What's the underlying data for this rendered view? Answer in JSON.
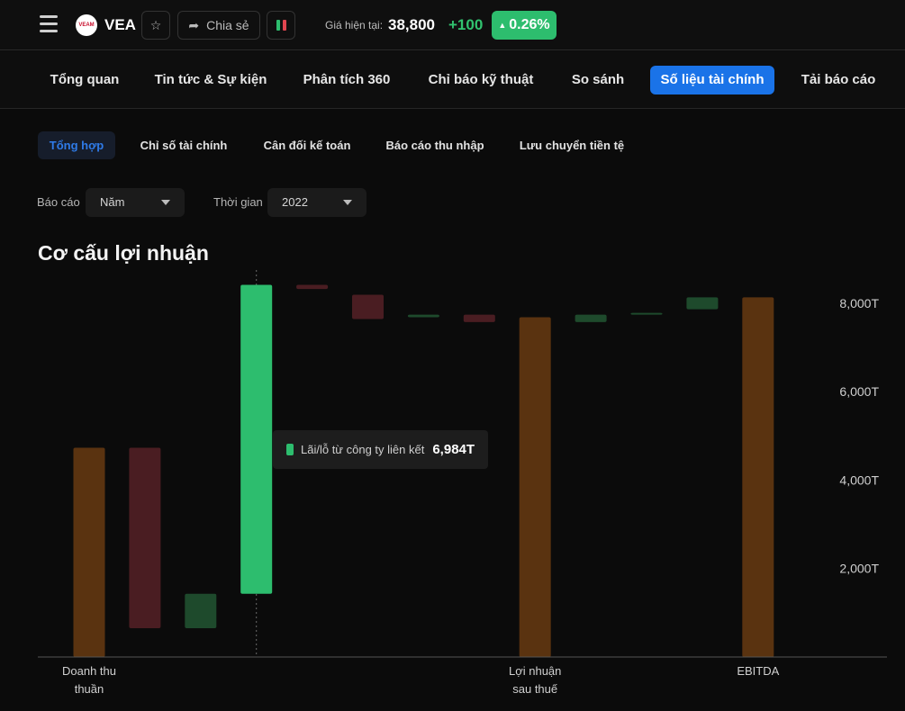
{
  "header": {
    "ticker": "VEA",
    "share_label": "Chia sẻ",
    "price_label": "Giá hiện tại:",
    "price_value": "38,800",
    "price_change": "+100",
    "price_change_pct": "0.26%",
    "icons": {
      "menu": "menu-icon",
      "star": "star-icon",
      "share": "share-icon",
      "candles": "candlestick-icon"
    }
  },
  "main_tabs": [
    "Tổng quan",
    "Tin tức & Sự kiện",
    "Phân tích 360",
    "Chỉ báo kỹ thuật",
    "So sánh",
    "Số liệu tài chính",
    "Tải báo cáo"
  ],
  "active_main_tab": "Số liệu tài chính",
  "sub_tabs": [
    "Tổng hợp",
    "Chỉ số tài chính",
    "Cân đối kế toán",
    "Báo cáo thu nhập",
    "Lưu chuyển tiền tệ"
  ],
  "active_sub_tab": "Tổng hợp",
  "filters": {
    "report_label": "Báo cáo",
    "report_value": "Năm",
    "time_label": "Thời gian",
    "time_value": "2022"
  },
  "chart_title": "Cơ cấu lợi nhuận",
  "tooltip": {
    "label": "Lãi/lỗ từ công ty liên kết",
    "value": "6,984T"
  },
  "colors": {
    "total": "#5a3310",
    "negative": "#4a1d22",
    "positive": "#1e4a2c",
    "highlight": "#2dbd6e",
    "accent": "#1a73e8"
  },
  "chart_data": {
    "type": "bar",
    "subtype": "waterfall",
    "unit": "T",
    "ylim": [
      0,
      8400
    ],
    "yticks": [
      2000,
      4000,
      6000,
      8000
    ],
    "ytick_labels": [
      "2,000T",
      "4,000T",
      "6,000T",
      "8,000T"
    ],
    "category_labels": [
      {
        "index": 0,
        "lines": [
          "Doanh thu",
          "thuần"
        ]
      },
      {
        "index": 8,
        "lines": [
          "Lợi nhuận",
          "sau thuế"
        ]
      },
      {
        "index": 12,
        "lines": [
          "EBITDA"
        ]
      }
    ],
    "bars": [
      {
        "kind": "total",
        "start": 0,
        "end": 4730
      },
      {
        "kind": "negative",
        "start": 4730,
        "end": 650
      },
      {
        "kind": "positive",
        "start": 650,
        "end": 1430
      },
      {
        "kind": "highlight",
        "start": 1430,
        "end": 8414
      },
      {
        "kind": "negative",
        "start": 8414,
        "end": 8320
      },
      {
        "kind": "negative",
        "start": 8190,
        "end": 7640
      },
      {
        "kind": "positive",
        "start": 7680,
        "end": 7740
      },
      {
        "kind": "negative",
        "start": 7740,
        "end": 7570
      },
      {
        "kind": "total",
        "start": 0,
        "end": 7680
      },
      {
        "kind": "positive",
        "start": 7570,
        "end": 7740
      },
      {
        "kind": "positive",
        "start": 7740,
        "end": 7780
      },
      {
        "kind": "positive",
        "start": 7860,
        "end": 8130
      },
      {
        "kind": "total",
        "start": 0,
        "end": 8130
      }
    ],
    "hover_index": 3,
    "grid": false,
    "legend": "none"
  }
}
